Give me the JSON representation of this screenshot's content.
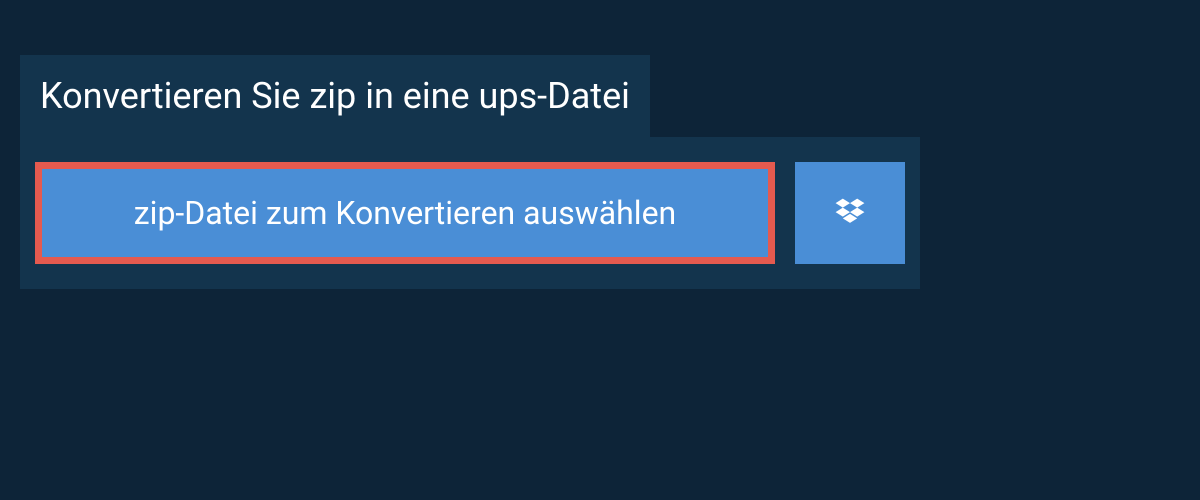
{
  "title": "Konvertieren Sie zip in eine ups-Datei",
  "select_button_label": "zip-Datei zum Konvertieren auswählen"
}
